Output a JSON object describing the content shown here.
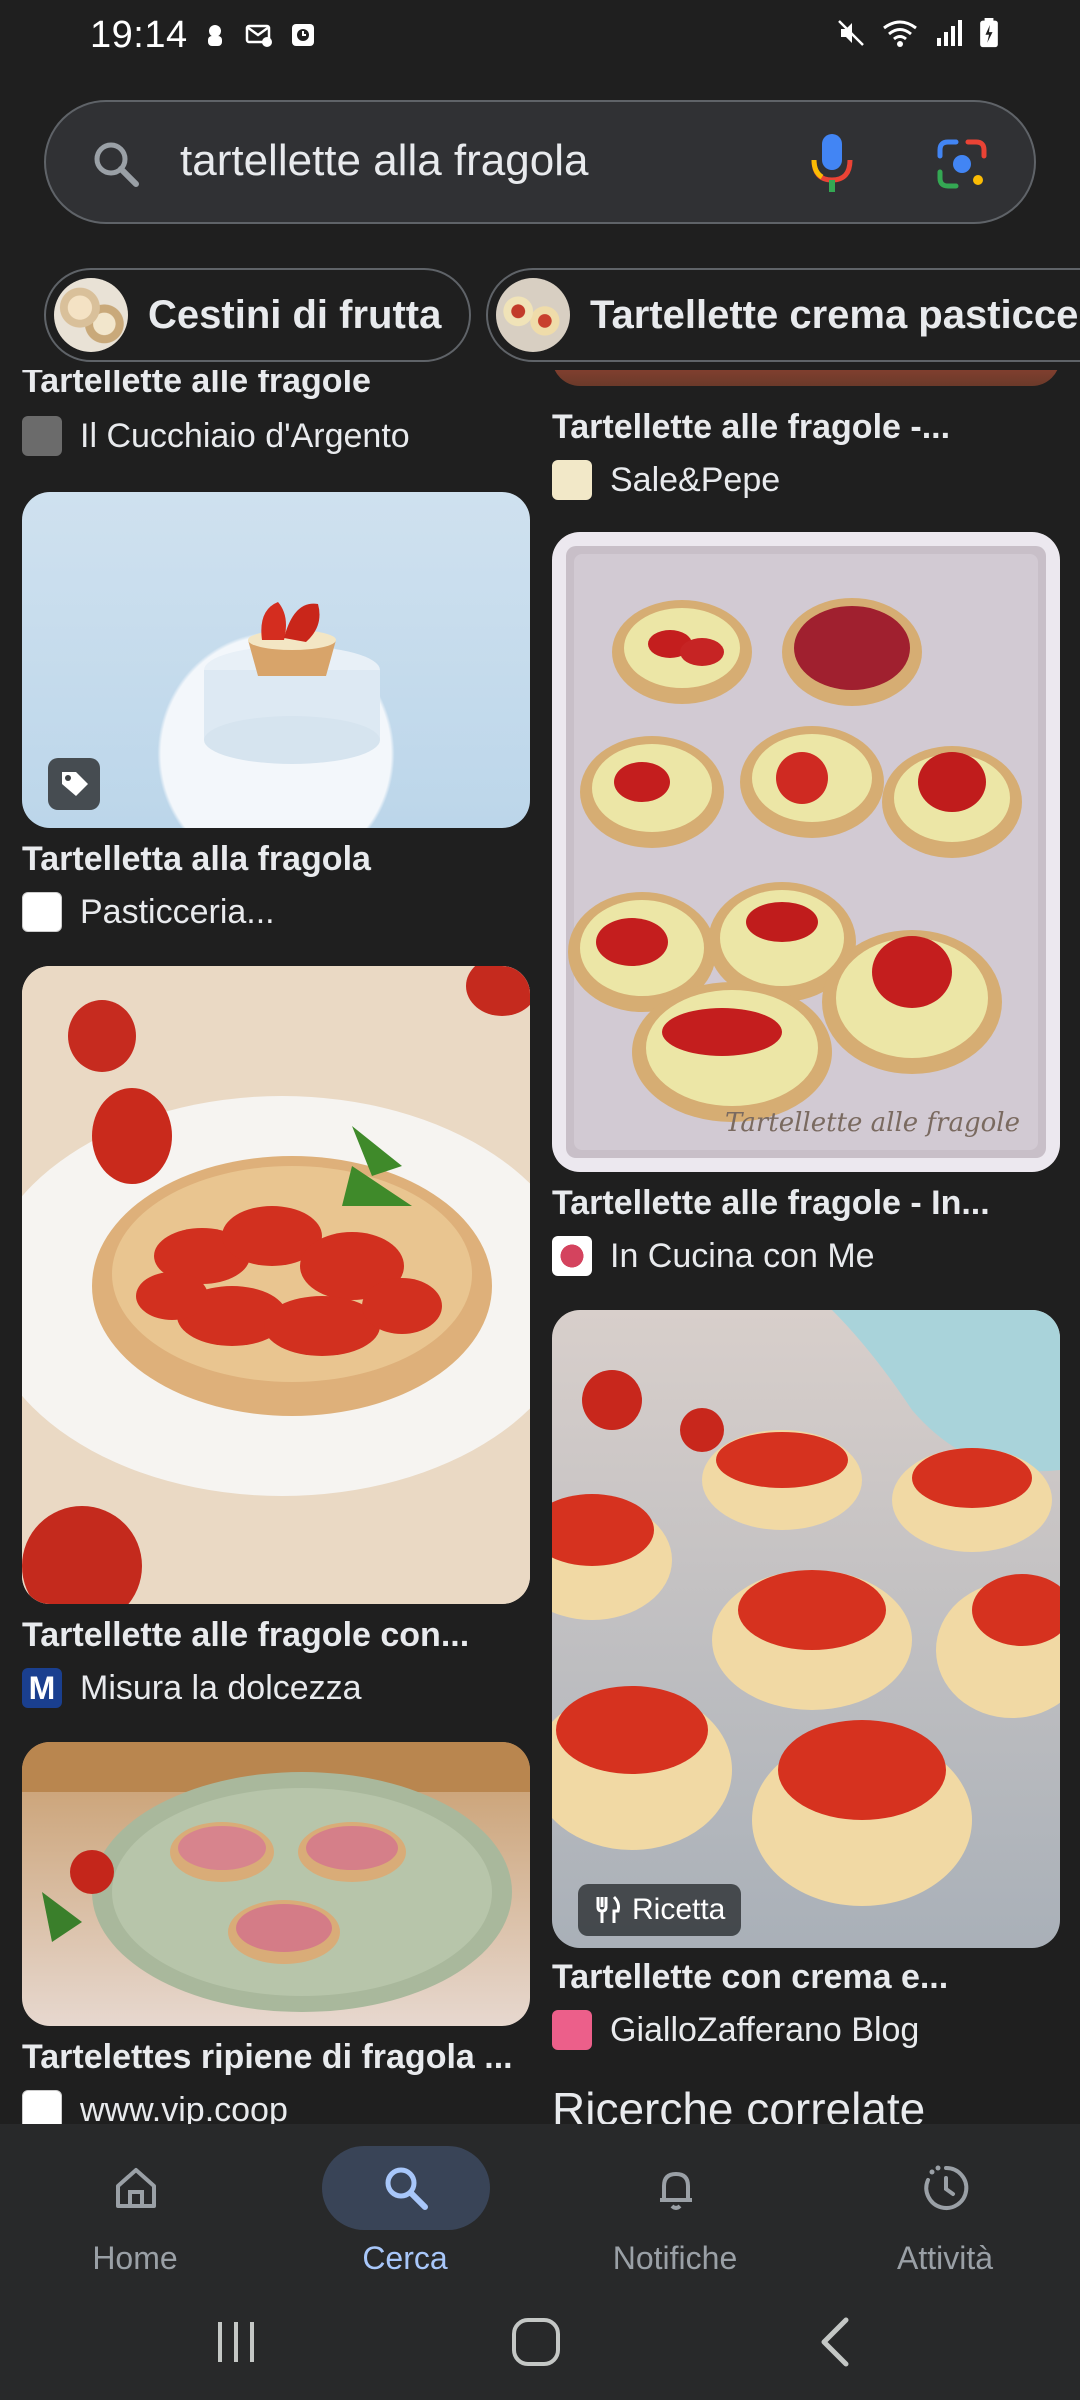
{
  "status_bar": {
    "time": "19:14"
  },
  "search": {
    "query": "tartellette alla fragola"
  },
  "chips": [
    {
      "label": "Cestini di frutta"
    },
    {
      "label": "Tartellette crema pasticcera"
    }
  ],
  "results": {
    "left": [
      {
        "title": "Tartellette alle fragole",
        "source": "Il Cucchiaio d'Argento"
      },
      {
        "title": "Tartelletta alla fragola",
        "source": "Pasticceria..."
      },
      {
        "title": "Tartellette alle fragole con...",
        "source": "Misura la dolcezza"
      },
      {
        "title": "Tartelettes ripiene di fragola ...",
        "source": "www.vip.coop"
      }
    ],
    "right": [
      {
        "title": "Tartellette alle fragole -...",
        "source": "Sale&Pepe"
      },
      {
        "title": "Tartellette alle fragole - In...",
        "source": "In Cucina con Me",
        "watermark": "Tartellette alle fragole"
      },
      {
        "title": "Tartellette con crema e...",
        "source": "GialloZafferano Blog",
        "badge": "Ricetta"
      }
    ]
  },
  "related": {
    "title": "Ricerche correlate"
  },
  "bottom_nav": [
    {
      "label": "Home",
      "icon": "home-icon",
      "active": false
    },
    {
      "label": "Cerca",
      "icon": "search-icon",
      "active": true
    },
    {
      "label": "Notifiche",
      "icon": "bell-icon",
      "active": false
    },
    {
      "label": "Attività",
      "icon": "activity-icon",
      "active": false
    }
  ],
  "colors": {
    "background": "#1f1f1f",
    "search_bg": "#303134",
    "accent": "#a8c7fa",
    "active_pill": "#394457",
    "text": "#e8eaed",
    "muted": "#9aa0a6"
  }
}
